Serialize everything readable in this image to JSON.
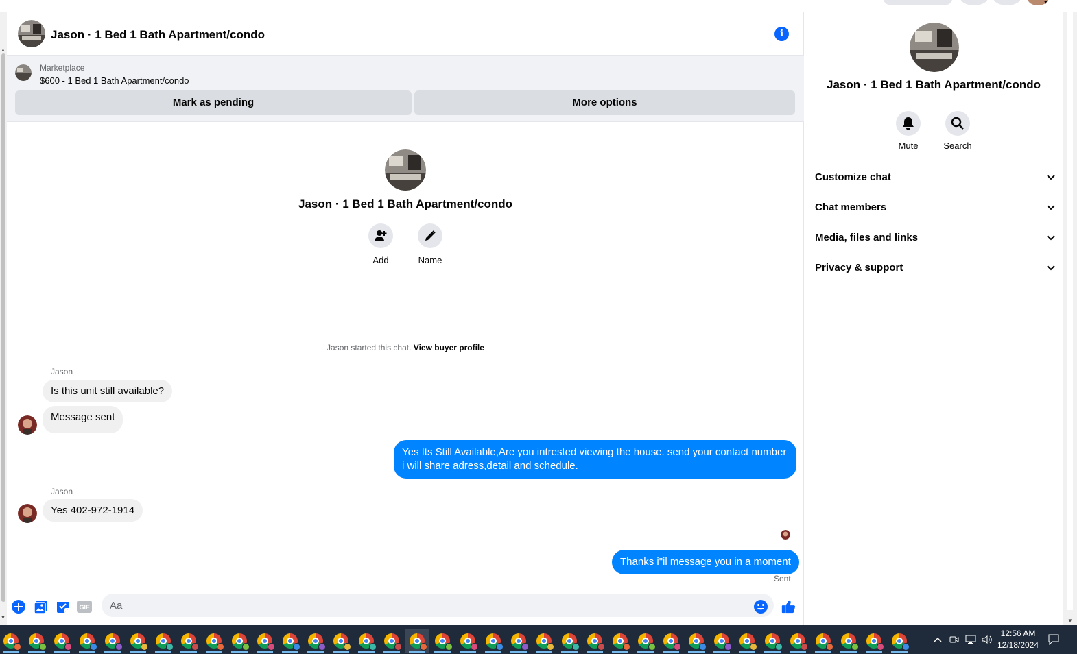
{
  "chat": {
    "title": "Jason · 1 Bed 1 Bath Apartment/condo",
    "info_icon": "info-icon",
    "marketplace": {
      "label": "Marketplace",
      "listing": "$600 - 1 Bed 1 Bath Apartment/condo",
      "mark_pending": "Mark as pending",
      "more_options": "More options"
    },
    "intro": {
      "title": "Jason · 1 Bed 1 Bath Apartment/condo",
      "add_label": "Add",
      "name_label": "Name"
    },
    "started_text": "Jason started this chat.",
    "view_profile": "View buyer profile",
    "messages": [
      {
        "sender": "Jason",
        "text": "Is this unit still available?",
        "dir": "in"
      },
      {
        "text": "Message sent",
        "dir": "in"
      },
      {
        "text": "Yes Its Still Available,Are you intrested viewing the house. send your contact number i will share adress,detail and schedule.",
        "dir": "out"
      },
      {
        "sender": "Jason",
        "text": "Yes 402-972-1914",
        "dir": "in"
      },
      {
        "text": "Thanks i\"il message you in a moment",
        "dir": "out",
        "status": "Sent"
      }
    ],
    "composer": {
      "placeholder": "Aa",
      "icons": [
        "plus-circle-icon",
        "image-icon",
        "sticker-icon",
        "gif-icon",
        "emoji-icon",
        "thumbs-up-icon"
      ],
      "gif_label": "GIF"
    }
  },
  "info_panel": {
    "title": "Jason · 1 Bed 1 Bath Apartment/condo",
    "actions": [
      {
        "label": "Mute",
        "icon": "bell-icon"
      },
      {
        "label": "Search",
        "icon": "search-icon"
      }
    ],
    "sections": [
      {
        "label": "Customize chat"
      },
      {
        "label": "Chat members"
      },
      {
        "label": "Media, files and links"
      },
      {
        "label": "Privacy & support"
      }
    ]
  },
  "taskbar": {
    "time": "12:56 AM",
    "date": "12/18/2024",
    "app_count": 36
  },
  "colors": {
    "accent": "#0866ff",
    "bubble_out": "#0084ff",
    "bubble_in": "#f0f0f0",
    "taskbar": "#1f2b3a"
  }
}
